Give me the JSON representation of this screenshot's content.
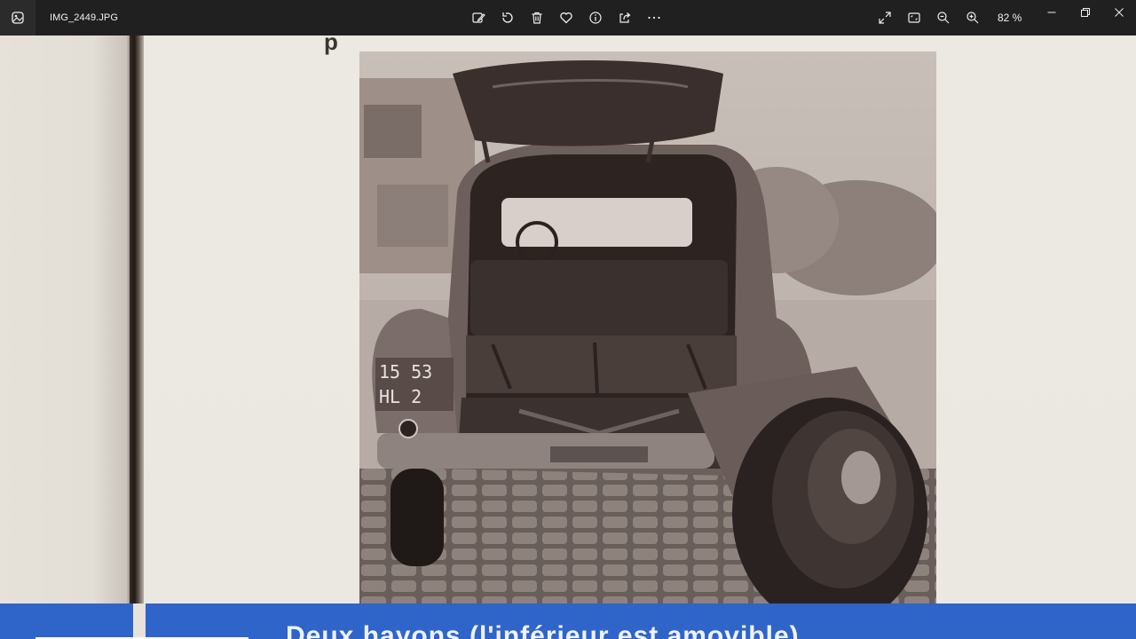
{
  "window": {
    "file_name": "IMG_2449.JPG",
    "zoom_level": "82 %"
  },
  "toolbar": {
    "buttons": [
      {
        "name": "edit-image-button",
        "icon": "edit-image-icon"
      },
      {
        "name": "rotate-button",
        "icon": "rotate-icon"
      },
      {
        "name": "delete-button",
        "icon": "trash-icon"
      },
      {
        "name": "favorite-button",
        "icon": "heart-icon"
      },
      {
        "name": "info-button",
        "icon": "info-icon"
      },
      {
        "name": "share-button",
        "icon": "share-icon"
      },
      {
        "name": "more-button",
        "icon": "more-dots-icon"
      }
    ],
    "right_buttons": [
      {
        "name": "fullscreen-button",
        "icon": "expand-icon"
      },
      {
        "name": "fit-to-window-button",
        "icon": "fit-window-icon"
      },
      {
        "name": "zoom-out-button",
        "icon": "zoom-out-icon"
      },
      {
        "name": "zoom-in-button",
        "icon": "zoom-in-icon"
      }
    ]
  },
  "photo": {
    "plate_line1": "15 53",
    "plate_line2": "HL 2",
    "caption": "Deux hayons (l'inférieur est amovible)",
    "top_fragment": "p"
  },
  "colors": {
    "titlebar": "#202020",
    "band": "#2f64c9",
    "paper": "#ebe7e1"
  }
}
